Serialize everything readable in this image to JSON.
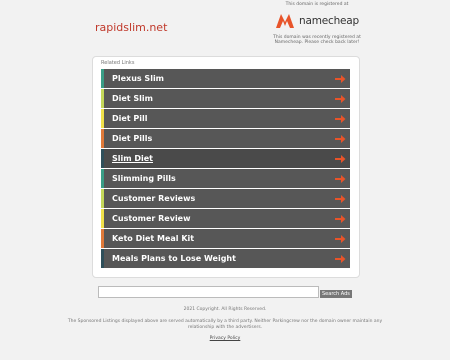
{
  "header": {
    "domain": "rapidslim.net",
    "registrar_intro": "This domain is registered at",
    "registrar_name": "namecheap",
    "registrar_note": "This domain was recently registered at Namecheap. Please check back later!"
  },
  "related": {
    "title": "Related Links",
    "items": [
      {
        "label": "Plexus Slim",
        "color": "#3a9e86"
      },
      {
        "label": "Diet Slim",
        "color": "#c4d85a"
      },
      {
        "label": "Diet Pill",
        "color": "#f0e14a"
      },
      {
        "label": "Diet Pills",
        "color": "#e07a3a"
      },
      {
        "label": "Slim Diet",
        "color": "#2f4f5a"
      },
      {
        "label": "Slimming Pills",
        "color": "#3a9e86"
      },
      {
        "label": "Customer Reviews",
        "color": "#c4d85a"
      },
      {
        "label": "Customer Review",
        "color": "#f0e14a"
      },
      {
        "label": "Keto Diet Meal Kit",
        "color": "#e07a3a"
      },
      {
        "label": "Meals Plans to Lose Weight",
        "color": "#2f4f5a"
      }
    ],
    "highlighted_index": 4,
    "arrow_color": "#e8542a"
  },
  "search": {
    "input_value": "",
    "button_label": "Search Ads"
  },
  "footer": {
    "copyright": "2021 Copyright. All Rights Reserved.",
    "disclaimer": "The Sponsored Listings displayed above are served automatically by a third party. Neither Parkingcrew nor the domain owner maintain any relationship with the advertisers.",
    "privacy_label": "Privacy Policy"
  }
}
